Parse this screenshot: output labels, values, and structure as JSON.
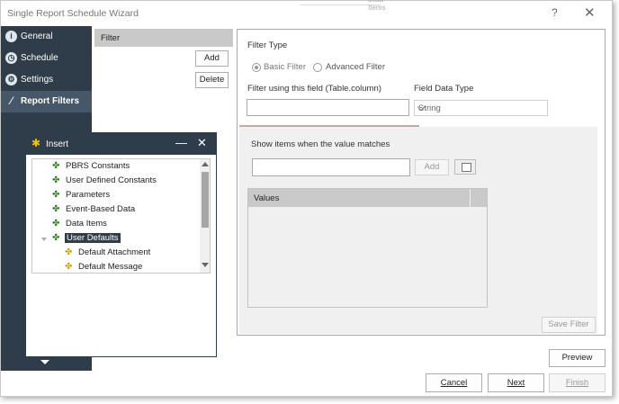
{
  "window": {
    "title": "Single Report Schedule Wizard",
    "help": "?",
    "close": "✕",
    "ghost_tab": "Data Items"
  },
  "nav": {
    "items": [
      {
        "label": "General",
        "icon": "info-icon",
        "glyph": "i"
      },
      {
        "label": "Schedule",
        "icon": "clock-icon",
        "glyph": "◷"
      },
      {
        "label": "Settings",
        "icon": "gear-icon",
        "glyph": "⚙"
      },
      {
        "label": "Report Filters",
        "icon": "filter-icon",
        "glyph": "⁄",
        "active": true
      }
    ]
  },
  "filter_list": {
    "header": "Filter",
    "add_label": "Add",
    "delete_label": "Delete"
  },
  "details": {
    "filter_type_label": "Filter Type",
    "basic_filter": "Basic Filter",
    "advanced_filter": "Advanced Filter",
    "field_label": "Filter using this field (Table.column)",
    "field_value": "",
    "data_type_label": "Field Data Type",
    "data_type_value": "String",
    "match_label": "Show items when the value matches",
    "match_value": "",
    "add_value_label": "Add",
    "values_header": "Values",
    "save_filter_label": "Save Filter"
  },
  "insert": {
    "title": "Insert",
    "min": "—",
    "close": "✕",
    "items": [
      {
        "label": "PBRS Constants",
        "icon": "puzzle-icon"
      },
      {
        "label": "User Defined Constants",
        "icon": "puzzle-icon"
      },
      {
        "label": "Parameters",
        "icon": "puzzle-icon"
      },
      {
        "label": "Event-Based Data",
        "icon": "puzzle-icon"
      },
      {
        "label": "Data Items",
        "icon": "puzzle-icon"
      },
      {
        "label": "User Defaults",
        "icon": "puzzle-icon",
        "selected": true
      },
      {
        "label": "Default Attachment",
        "icon": "gold-puzzle-icon"
      },
      {
        "label": "Default Message",
        "icon": "gold-puzzle-icon"
      }
    ]
  },
  "footer": {
    "preview_label": "Preview",
    "cancel_label": "Cancel",
    "next_label": "Next",
    "finish_label": "Finish"
  },
  "colors": {
    "nav_bg": "#2e3d49",
    "nav_active": "#46576a",
    "header_gray": "#c9c9c9"
  }
}
